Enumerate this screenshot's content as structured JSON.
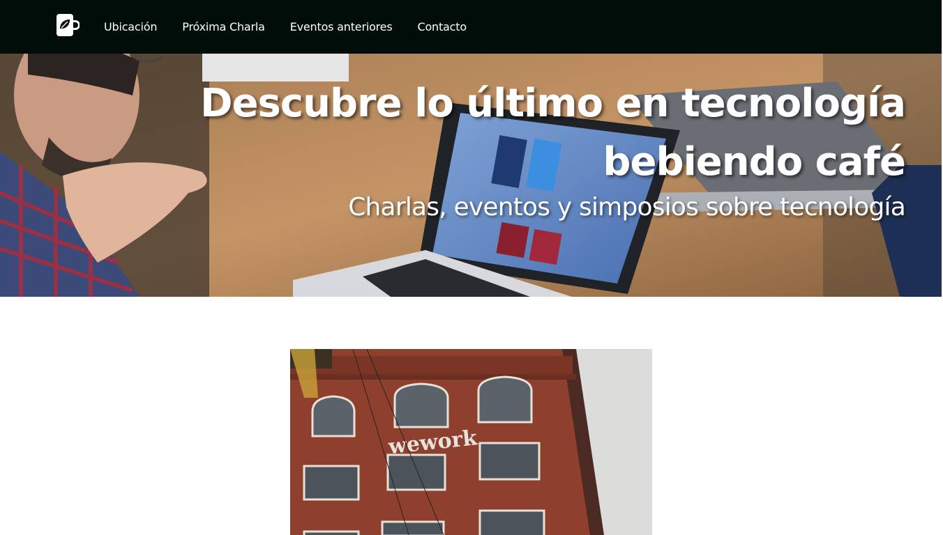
{
  "nav": {
    "logo_icon": "coffee-cup-leaf-icon",
    "links": [
      {
        "label": "Ubicación"
      },
      {
        "label": "Próxima Charla"
      },
      {
        "label": "Eventos anteriores"
      },
      {
        "label": "Contacto"
      }
    ]
  },
  "hero": {
    "title_line1": "Descubre lo último en tecnología",
    "title_line2": "bebiendo café",
    "subtitle": "Charlas, eventos y simposios sobre tecnología"
  },
  "venue": {
    "sign_text": "wework"
  },
  "colors": {
    "nav_bg": "#000d08",
    "text_light": "#ffffff",
    "brick": "#8e3f2e"
  }
}
